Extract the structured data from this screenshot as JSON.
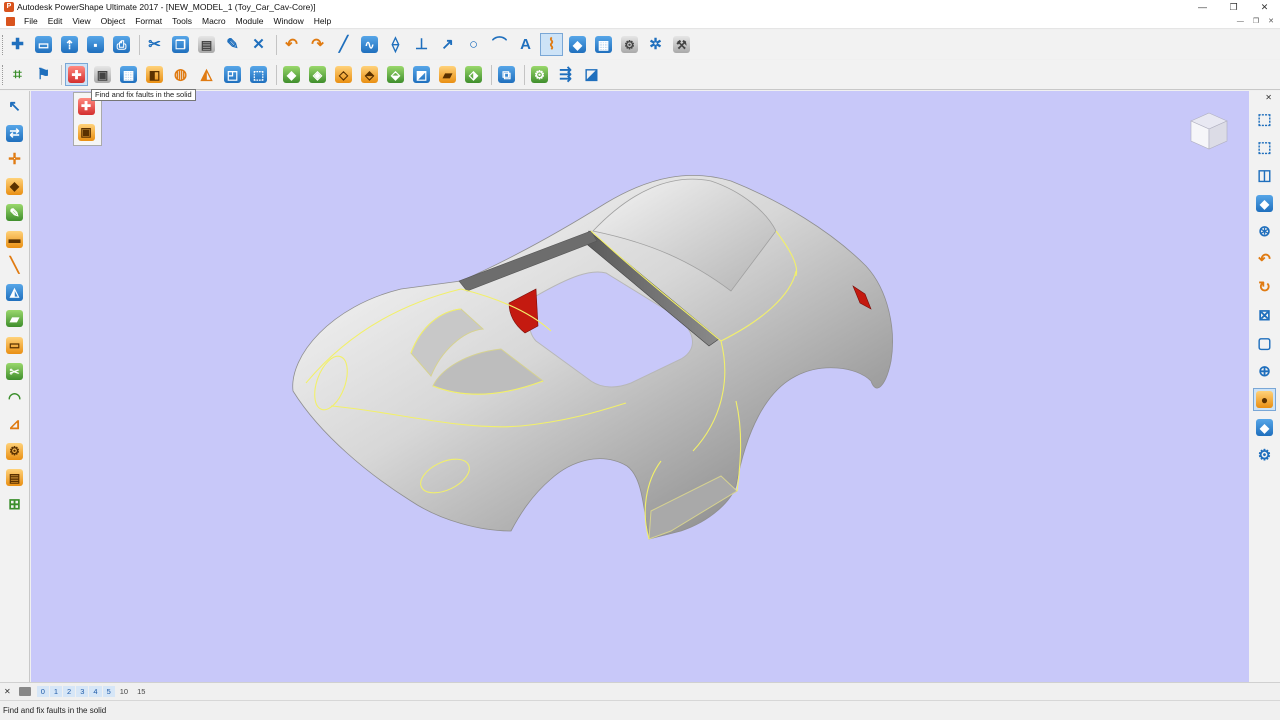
{
  "window": {
    "title": "Autodesk PowerShape Ultimate 2017 - [NEW_MODEL_1 (Toy_Car_Cav-Core)]",
    "app_icon": "P",
    "controls": [
      "—",
      "❐",
      "✕"
    ]
  },
  "menu": {
    "items": [
      "File",
      "Edit",
      "View",
      "Object",
      "Format",
      "Tools",
      "Macro",
      "Module",
      "Window",
      "Help"
    ],
    "mdi_controls": [
      "—",
      "❐",
      "✕"
    ]
  },
  "toolbar1": {
    "icons": [
      "new-model-icon",
      "open-icon",
      "import-icon",
      "save-icon",
      "print-icon",
      "cut-icon",
      "copy-icon",
      "paste-icon",
      "edit-icon",
      "delete-icon",
      "undo-icon",
      "redo-icon",
      "line-icon",
      "curve-icon",
      "surface-icon",
      "workplane-icon",
      "dimension-icon",
      "circle-icon",
      "arc-icon",
      "text-icon",
      "composite-curve-icon",
      "solid-icon",
      "surface-modelling-icon",
      "assembly-icon",
      "wizard-icon",
      "toolkit-icon"
    ]
  },
  "toolbar2": {
    "icons": [
      "drafting-icon",
      "fix-faults-icon",
      "solid-tree-icon",
      "block-icon",
      "slice-icon",
      "section-icon",
      "shell-icon",
      "fillet-icon",
      "box-icon",
      "feature-icon",
      "boolean-icon",
      "draft-icon",
      "extrude-icon",
      "revolve-icon",
      "split-icon",
      "pattern-icon",
      "transform-icon",
      "mirror-icon",
      "group-icon",
      "tree-icon",
      "analysis-icon"
    ],
    "active_tool": "fix-faults-icon"
  },
  "tooltip": {
    "text": "Find and fix faults in the solid"
  },
  "flyout": {
    "icons": [
      "fix-faults-icon",
      "repair-solid-icon"
    ]
  },
  "left_toolbar": {
    "icons": [
      "select-icon",
      "selection-filter-icon",
      "point-icon",
      "line-icon",
      "arc-icon",
      "curve-icon",
      "surface-icon",
      "solid-icon",
      "text-icon",
      "dimension-icon",
      "mesh-icon",
      "workplane-icon",
      "electrode-icon",
      "trim-icon",
      "wireframe-icon",
      "fill-icon",
      "level-icon"
    ]
  },
  "right_toolbar": {
    "icons": [
      "view-top-icon",
      "view-front-icon",
      "view-right-icon",
      "view-iso-icon",
      "view-rotate-icon",
      "undo-view-icon",
      "redo-view-icon",
      "zoom-fit-icon",
      "zoom-box-icon",
      "wireframe-shading-icon",
      "shaded-icon",
      "lighting-icon",
      "preferences-icon"
    ]
  },
  "levels": {
    "items": [
      "0",
      "1",
      "2",
      "3",
      "4",
      "5",
      "10",
      "15"
    ],
    "active": [
      "0",
      "1",
      "2",
      "3",
      "4",
      "5"
    ]
  },
  "status": {
    "text": "Find and fix faults in the solid"
  },
  "colors": {
    "viewport_background": "#c8c8f9",
    "model_body": "#d9d9d9",
    "edge_highlight": "#f2f06a",
    "fault_face": "#c41a10"
  }
}
